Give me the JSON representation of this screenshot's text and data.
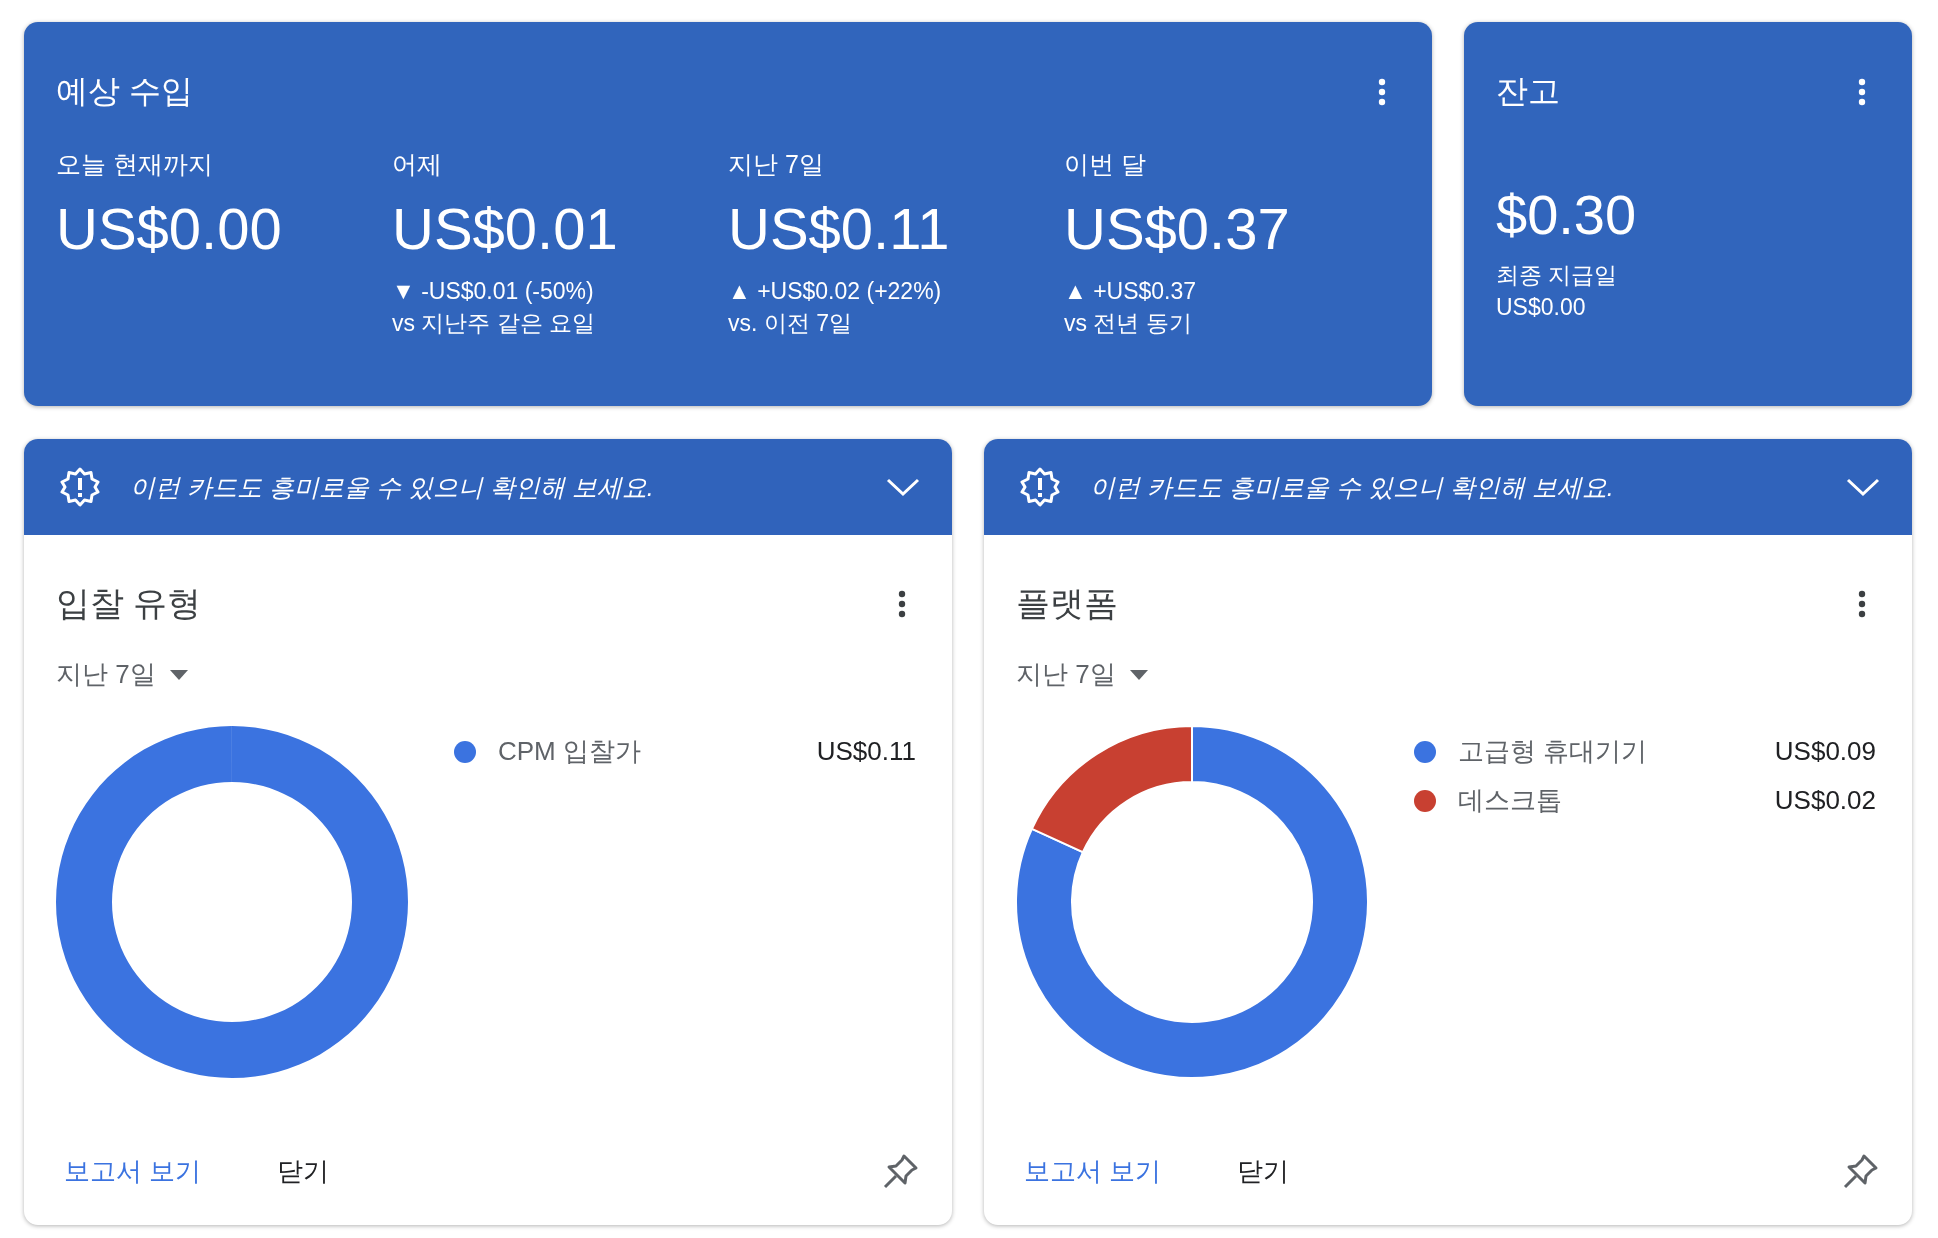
{
  "earnings": {
    "title": "예상 수입",
    "stats": [
      {
        "label": "오늘 현재까지",
        "amount": "US$0.00"
      },
      {
        "label": "어제",
        "amount": "US$0.01",
        "change": "▼ -US$0.01 (-50%)",
        "compare": "vs 지난주 같은 요일"
      },
      {
        "label": "지난 7일",
        "amount": "US$0.11",
        "change": "▲ +US$0.02 (+22%)",
        "compare": "vs. 이전 7일"
      },
      {
        "label": "이번 달",
        "amount": "US$0.37",
        "change": "▲ +US$0.37",
        "compare": "vs 전년 동기"
      }
    ]
  },
  "balance": {
    "title": "잔고",
    "amount": "$0.30",
    "label": "최종 지급일",
    "last_payment": "US$0.00"
  },
  "cards": [
    {
      "banner": "이런 카드도 흥미로울 수 있으니 확인해 보세요.",
      "title": "입찰 유형",
      "period": "지난 7일",
      "legend": [
        {
          "value": "US$0.11",
          "color": "#3b73e0"
        }
      ],
      "chart_data": {
        "type": "donut",
        "categories": [
          "CPM 입찰가"
        ],
        "values": [
          100
        ]
      },
      "actions": [
        "보고서 보기",
        "닫기"
      ]
    },
    {
      "banner": "이런 카드도 흥미로울 수 있으니 확인해 보세요.",
      "title": "플랫폼",
      "period": "지난 7일",
      "legend": [
        {
          "value": "US$0.09",
          "color": "#3b73e0"
        },
        {
          "value": "US$0.02",
          "color": "#c84031"
        }
      ],
      "chart_data": {
        "type": "donut",
        "categories": [
          "고급형 휴대기기",
          "데스크톱"
        ],
        "values": [
          81.82,
          18.18
        ]
      },
      "actions": [
        "보고서 보기",
        "닫기"
      ]
    }
  ]
}
